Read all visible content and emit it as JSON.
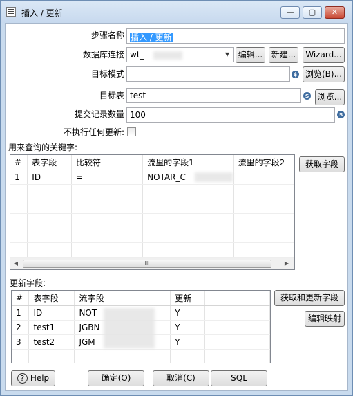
{
  "window": {
    "title": "插入 / 更新",
    "minimize": "—",
    "maximize": "▢",
    "close": "✕"
  },
  "form": {
    "step_name_label": "步骤名称",
    "step_name_value": "插入 / 更新",
    "db_conn_label": "数据库连接",
    "db_conn_value": "wt_",
    "edit_button": "编辑...",
    "new_button": "新建...",
    "wizard_button": "Wizard...",
    "target_schema_label": "目标模式",
    "target_schema_value": "",
    "browse_schema_button_text": "浏览(",
    "browse_schema_button_key": "B",
    "browse_schema_button_end": ")...",
    "target_table_label": "目标表",
    "target_table_value": "test",
    "browse_table_button": "浏览...",
    "commit_label": "提交记录数量",
    "commit_value": "100",
    "no_update_label": "不执行任何更新:",
    "variable_icon": "$"
  },
  "key_section": {
    "label": "用来查询的关键字:",
    "get_fields_button": "获取字段",
    "columns": [
      "#",
      "表字段",
      "比较符",
      "流里的字段1",
      "流里的字段2"
    ],
    "rows": [
      [
        "1",
        "ID",
        "=",
        "NOTAR_C",
        ""
      ]
    ],
    "scroll_grip": "III"
  },
  "update_section": {
    "label": "更新字段:",
    "get_update_button": "获取和更新字段",
    "edit_mapping_button": "编辑映射",
    "columns": [
      "#",
      "表字段",
      "流字段",
      "更新"
    ],
    "rows": [
      [
        "1",
        "ID",
        "NOT",
        "Y"
      ],
      [
        "2",
        "test1",
        "JGBN",
        "Y"
      ],
      [
        "3",
        "test2",
        "JGM",
        "Y"
      ]
    ]
  },
  "footer": {
    "help": "Help",
    "ok": "确定(O)",
    "cancel": "取消(C)",
    "sql": "SQL"
  }
}
